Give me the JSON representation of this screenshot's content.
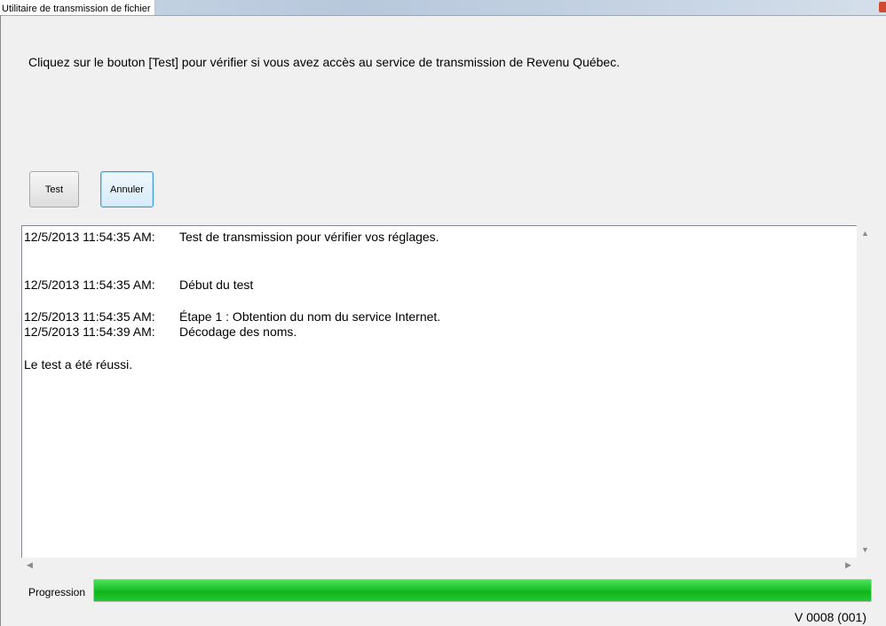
{
  "window": {
    "title": "Utilitaire de transmission de fichier"
  },
  "instruction": "Cliquez sur le bouton [Test] pour vérifier si vous avez accès au service de transmission de Revenu Québec.",
  "buttons": {
    "test_label": "Test",
    "cancel_label": "Annuler"
  },
  "log": [
    {
      "time": "12/5/2013 11:54:35 AM:",
      "message": "Test de transmission pour vérifier vos réglages."
    },
    {
      "time": "12/5/2013 11:54:35 AM:",
      "message": "Début du test"
    },
    {
      "time": "12/5/2013 11:54:35 AM:",
      "message": "Étape 1 : Obtention du nom du service Internet."
    },
    {
      "time": "12/5/2013 11:54:39 AM:",
      "message": "Décodage des noms."
    },
    {
      "time": "",
      "message": "Le test a été réussi."
    }
  ],
  "progress": {
    "label": "Progression",
    "value_percent": 100,
    "color": "#1ec22a"
  },
  "version": "V 0008 (001)"
}
